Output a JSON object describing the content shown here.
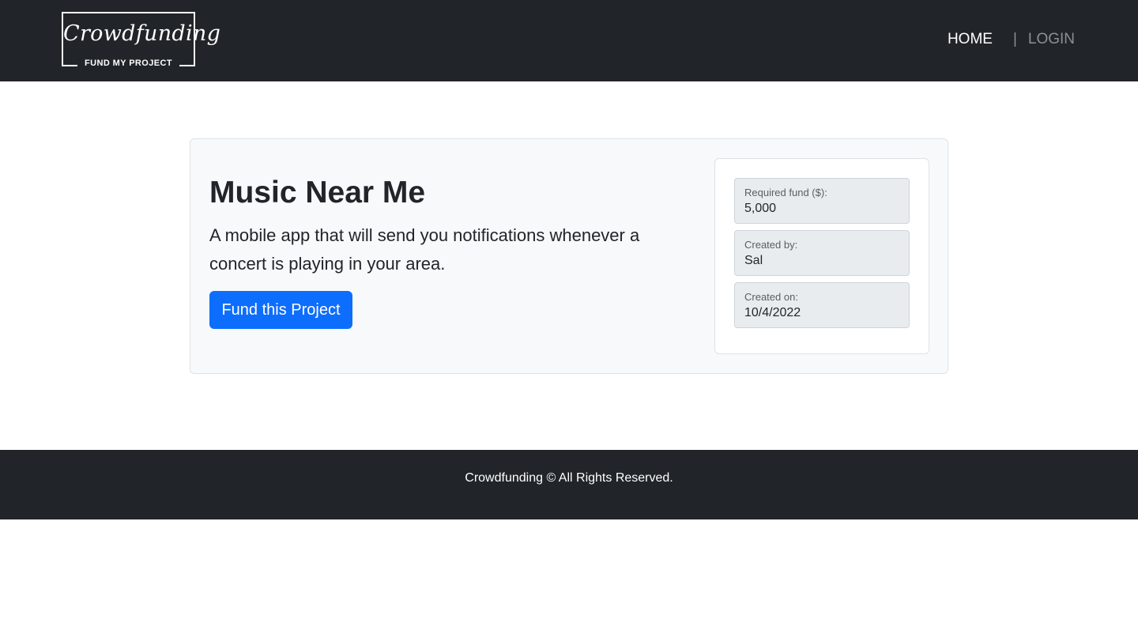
{
  "header": {
    "logo": {
      "script_text": "Crowdfunding",
      "tagline": "FUND MY PROJECT"
    },
    "nav": {
      "home": "HOME",
      "separator": "|",
      "login": "LOGIN"
    }
  },
  "project": {
    "title": "Music Near Me",
    "description": "A mobile app that will send you notifications whenever a concert is playing in your area.",
    "fund_button": "Fund this Project",
    "details": [
      {
        "label": "Required fund ($):",
        "value": "5,000"
      },
      {
        "label": "Created by:",
        "value": "Sal"
      },
      {
        "label": "Created on:",
        "value": "10/4/2022"
      }
    ]
  },
  "footer": {
    "text": "Crowdfunding © All Rights Reserved."
  },
  "colors": {
    "dark": "#212529",
    "primary": "#0d6efd",
    "card_bg": "#f8f9fa",
    "field_bg": "#e9ecef"
  }
}
